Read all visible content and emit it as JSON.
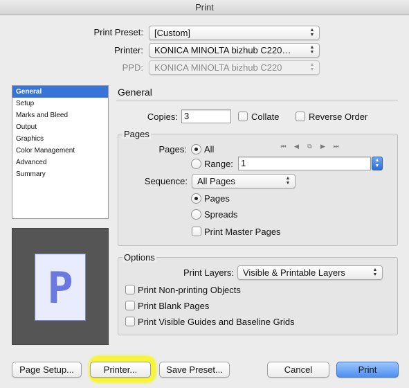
{
  "window": {
    "title": "Print"
  },
  "header": {
    "print_preset_label": "Print Preset:",
    "print_preset_value": "[Custom]",
    "printer_label": "Printer:",
    "printer_value": "KONICA MINOLTA bizhub C220…",
    "ppd_label": "PPD:",
    "ppd_value": "KONICA MINOLTA bizhub C220"
  },
  "sidebar": {
    "items": [
      {
        "label": "General"
      },
      {
        "label": "Setup"
      },
      {
        "label": "Marks and Bleed"
      },
      {
        "label": "Output"
      },
      {
        "label": "Graphics"
      },
      {
        "label": "Color Management"
      },
      {
        "label": "Advanced"
      },
      {
        "label": "Summary"
      }
    ],
    "selected": "General"
  },
  "preview": {
    "glyph": "P"
  },
  "general": {
    "title": "General",
    "copies_label": "Copies:",
    "copies_value": "3",
    "collate_label": "Collate",
    "collate_checked": false,
    "reverse_order_label": "Reverse Order",
    "reverse_order_checked": false
  },
  "pages": {
    "group_label": "Pages",
    "pages_label": "Pages:",
    "all_label": "All",
    "all_selected": true,
    "range_label": "Range:",
    "range_value": "1",
    "sequence_label": "Sequence:",
    "sequence_value": "All Pages",
    "pages_radio_label": "Pages",
    "pages_radio_selected": true,
    "spreads_label": "Spreads",
    "spreads_selected": false,
    "print_master_pages_label": "Print Master Pages",
    "print_master_pages_checked": false
  },
  "options": {
    "group_label": "Options",
    "print_layers_label": "Print Layers:",
    "print_layers_value": "Visible & Printable Layers",
    "non_printing_label": "Print Non-printing Objects",
    "blank_pages_label": "Print Blank Pages",
    "guides_label": "Print Visible Guides and Baseline Grids"
  },
  "buttons": {
    "page_setup": "Page Setup...",
    "printer": "Printer...",
    "save_preset": "Save Preset...",
    "cancel": "Cancel",
    "print": "Print"
  },
  "colors": {
    "selection": "#3874d8",
    "default_button": "#4f8ff0",
    "highlight": "#f6f53a"
  }
}
